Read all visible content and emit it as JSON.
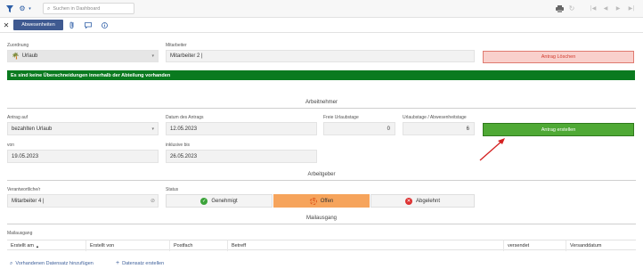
{
  "toolbar": {
    "search_placeholder": "Suchen in Dashboard",
    "icons": [
      "filter-icon",
      "gear-icon",
      "chevron-down-icon",
      "search-icon",
      "print-icon",
      "refresh-icon",
      "first-page-icon",
      "prev-page-icon",
      "next-page-icon",
      "last-page-icon"
    ]
  },
  "tabbar": {
    "active_tab": "Abwesenheiten",
    "icons": [
      "close-icon",
      "attachment-icon",
      "comment-icon",
      "info-icon"
    ]
  },
  "top": {
    "zuordnung_label": "Zuordnung",
    "zuordnung_value": "Urlaub",
    "mitarbeiter_label": "Mitarbeiter",
    "mitarbeiter_value": "Mitarbeiter 2 |",
    "delete_button": "Antrag Löschen",
    "banner": "Es sind keine Überschneidungen innerhalb der Abteilung vorhanden"
  },
  "arbeitnehmer": {
    "section_title": "Arbeitnehmer",
    "antrag_auf_label": "Antrag auf",
    "antrag_auf_value": "bezahlten Urlaub",
    "datum_label": "Datum des Antrags",
    "datum_value": "12.05.2023",
    "freie_label": "Freie Urlaubstage",
    "freie_value": "0",
    "urlaubstage_label": "Urlaubstage / Abwesenheitstage",
    "urlaubstage_value": "6",
    "create_button": "Antrag erstellen",
    "von_label": "von",
    "von_value": "19.05.2023",
    "bis_label": "inklusive bis",
    "bis_value": "26.05.2023"
  },
  "arbeitgeber": {
    "section_title": "Arbeitgeber",
    "verantwortlich_label": "Verantwortliche/r",
    "verantwortlich_value": "Mitarbeiter 4 |",
    "status_label": "Status",
    "status_options": [
      "Genehmigt",
      "Offen",
      "Abgelehnt"
    ],
    "status_selected": "Offen"
  },
  "mailausgang": {
    "section_title": "Mailausgang",
    "table_label": "Mailausgang",
    "columns": [
      "Erstellt am",
      "Erstellt von",
      "Postfach",
      "Betreff",
      "versendet",
      "Versanddatum"
    ],
    "sort_indicator": "▲",
    "add_existing": "Vorhandenen Datensatz hinzufügen",
    "create_record": "Datensatz erstellen"
  },
  "colors": {
    "accent": "#3f5a91",
    "banner_green": "#0a7a1f",
    "create_green": "#4fa935",
    "delete_red": "#d23b2e",
    "status_open": "#f6a45c",
    "arrow_red": "#d42020"
  }
}
